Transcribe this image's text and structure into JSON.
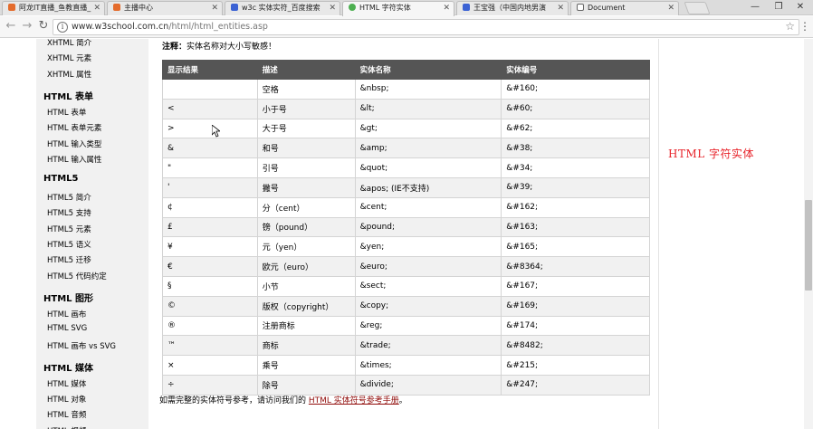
{
  "tabs": [
    {
      "title": "阿龙IT直播_鱼教直播_",
      "icon_color": "#e46b2c"
    },
    {
      "title": "主播中心",
      "icon_color": "#e46b2c"
    },
    {
      "title": "w3c 实体实符_百度搜索",
      "icon_color": "#3b62d4"
    },
    {
      "title": "HTML 字符实体",
      "icon_color": "#4caf50",
      "active": true
    },
    {
      "title": "王宝强（中国内地男演",
      "icon_color": "#3b62d4"
    },
    {
      "title": "Document",
      "icon_color": "#666666"
    }
  ],
  "window": {
    "minimize": "—",
    "maximize": "❐",
    "close": "✕"
  },
  "toolbar": {
    "back": "←",
    "forward": "→",
    "reload": "↻",
    "url_host": "www.w3school.com.cn",
    "url_path": "/html/html_entities.asp",
    "star": "☆",
    "menu": "⋮"
  },
  "sidebar": {
    "groups": [
      {
        "heading": null,
        "items": [
          "XHTML 简介",
          "XHTML 元素",
          "XHTML 属性"
        ]
      },
      {
        "heading": "HTML 表单",
        "items": [
          "HTML 表单",
          "HTML 表单元素",
          "HTML 输入类型",
          "HTML 输入属性"
        ]
      },
      {
        "heading": "HTML5",
        "items": [
          "HTML5 简介",
          "HTML5 支持",
          "HTML5 元素",
          "HTML5 语义",
          "HTML5 迁移",
          "HTML5 代码约定"
        ]
      },
      {
        "heading": "HTML 图形",
        "items": [
          "HTML 画布",
          "HTML SVG",
          "HTML 画布 vs SVG"
        ]
      },
      {
        "heading": "HTML 媒体",
        "items": [
          "HTML 媒体",
          "HTML 对象",
          "HTML 音频",
          "HTML 视频"
        ]
      }
    ]
  },
  "note": {
    "label": "注释：",
    "text": "实体名称对大小写敏感！"
  },
  "table": {
    "headers": [
      "显示结果",
      "描述",
      "实体名称",
      "实体编号"
    ],
    "rows": [
      [
        "",
        "空格",
        "&nbsp;",
        "&#160;"
      ],
      [
        "<",
        "小于号",
        "&lt;",
        "&#60;"
      ],
      [
        ">",
        "大于号",
        "&gt;",
        "&#62;"
      ],
      [
        "&",
        "和号",
        "&amp;",
        "&#38;"
      ],
      [
        "\"",
        "引号",
        "&quot;",
        "&#34;"
      ],
      [
        "'",
        "撇号",
        "&apos; (IE不支持)",
        "&#39;"
      ],
      [
        "¢",
        "分（cent）",
        "&cent;",
        "&#162;"
      ],
      [
        "£",
        "镑（pound）",
        "&pound;",
        "&#163;"
      ],
      [
        "¥",
        "元（yen）",
        "&yen;",
        "&#165;"
      ],
      [
        "€",
        "欧元（euro）",
        "&euro;",
        "&#8364;"
      ],
      [
        "§",
        "小节",
        "&sect;",
        "&#167;"
      ],
      [
        "©",
        "版权（copyright）",
        "&copy;",
        "&#169;"
      ],
      [
        "®",
        "注册商标",
        "&reg;",
        "&#174;"
      ],
      [
        "™",
        "商标",
        "&trade;",
        "&#8482;"
      ],
      [
        "×",
        "乘号",
        "&times;",
        "&#215;"
      ],
      [
        "÷",
        "除号",
        "&divide;",
        "&#247;"
      ]
    ]
  },
  "more": {
    "prefix": "如需完整的实体符号参考，请访问我们的 ",
    "link": "HTML 实体符号参考手册",
    "suffix": "。"
  },
  "overlay_text": "HTML  字符实体",
  "colors": {
    "link": "#900b09",
    "table_header": "#555555",
    "overlay": "#e8232a"
  }
}
